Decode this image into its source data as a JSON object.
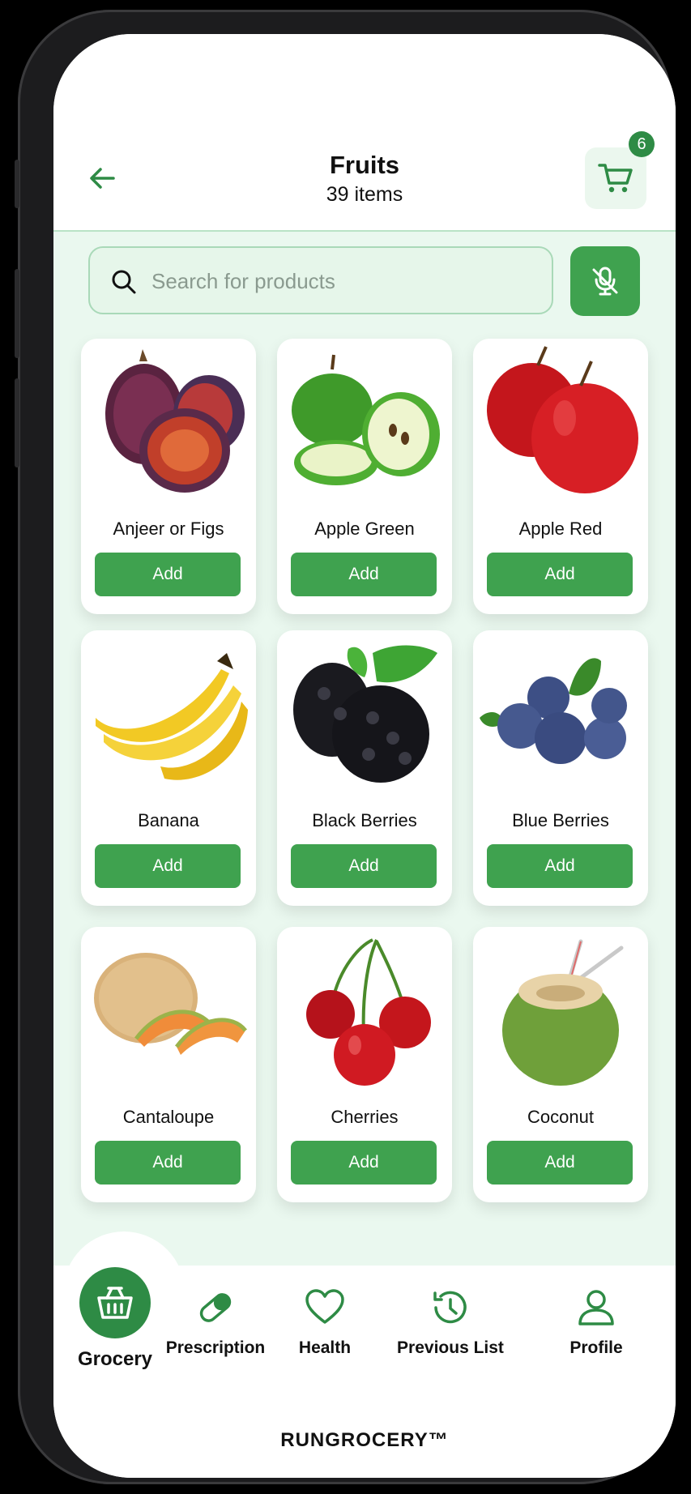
{
  "header": {
    "title": "Fruits",
    "subtitle": "39 items",
    "cart_count": "6"
  },
  "search": {
    "placeholder": "Search for products"
  },
  "products": [
    {
      "name": "Anjeer or Figs",
      "button": "Add"
    },
    {
      "name": "Apple Green",
      "button": "Add"
    },
    {
      "name": "Apple Red",
      "button": "Add"
    },
    {
      "name": "Banana",
      "button": "Add"
    },
    {
      "name": "Black Berries",
      "button": "Add"
    },
    {
      "name": "Blue Berries",
      "button": "Add"
    },
    {
      "name": "Cantaloupe",
      "button": "Add"
    },
    {
      "name": "Cherries",
      "button": "Add"
    },
    {
      "name": "Coconut",
      "button": "Add"
    }
  ],
  "nav": [
    {
      "label": "Grocery",
      "icon": "basket-icon",
      "active": true
    },
    {
      "label": "Prescription",
      "icon": "pill-icon",
      "active": false
    },
    {
      "label": "Health",
      "icon": "heart-icon",
      "active": false
    },
    {
      "label": "Previous List",
      "icon": "history-icon",
      "active": false
    },
    {
      "label": "Profile",
      "icon": "user-icon",
      "active": false
    }
  ],
  "footer": {
    "brand": "RUNGROCERY™"
  },
  "colors": {
    "accent": "#3fa24f",
    "accent_dark": "#2e8b45",
    "background": "#eaf8ef"
  }
}
